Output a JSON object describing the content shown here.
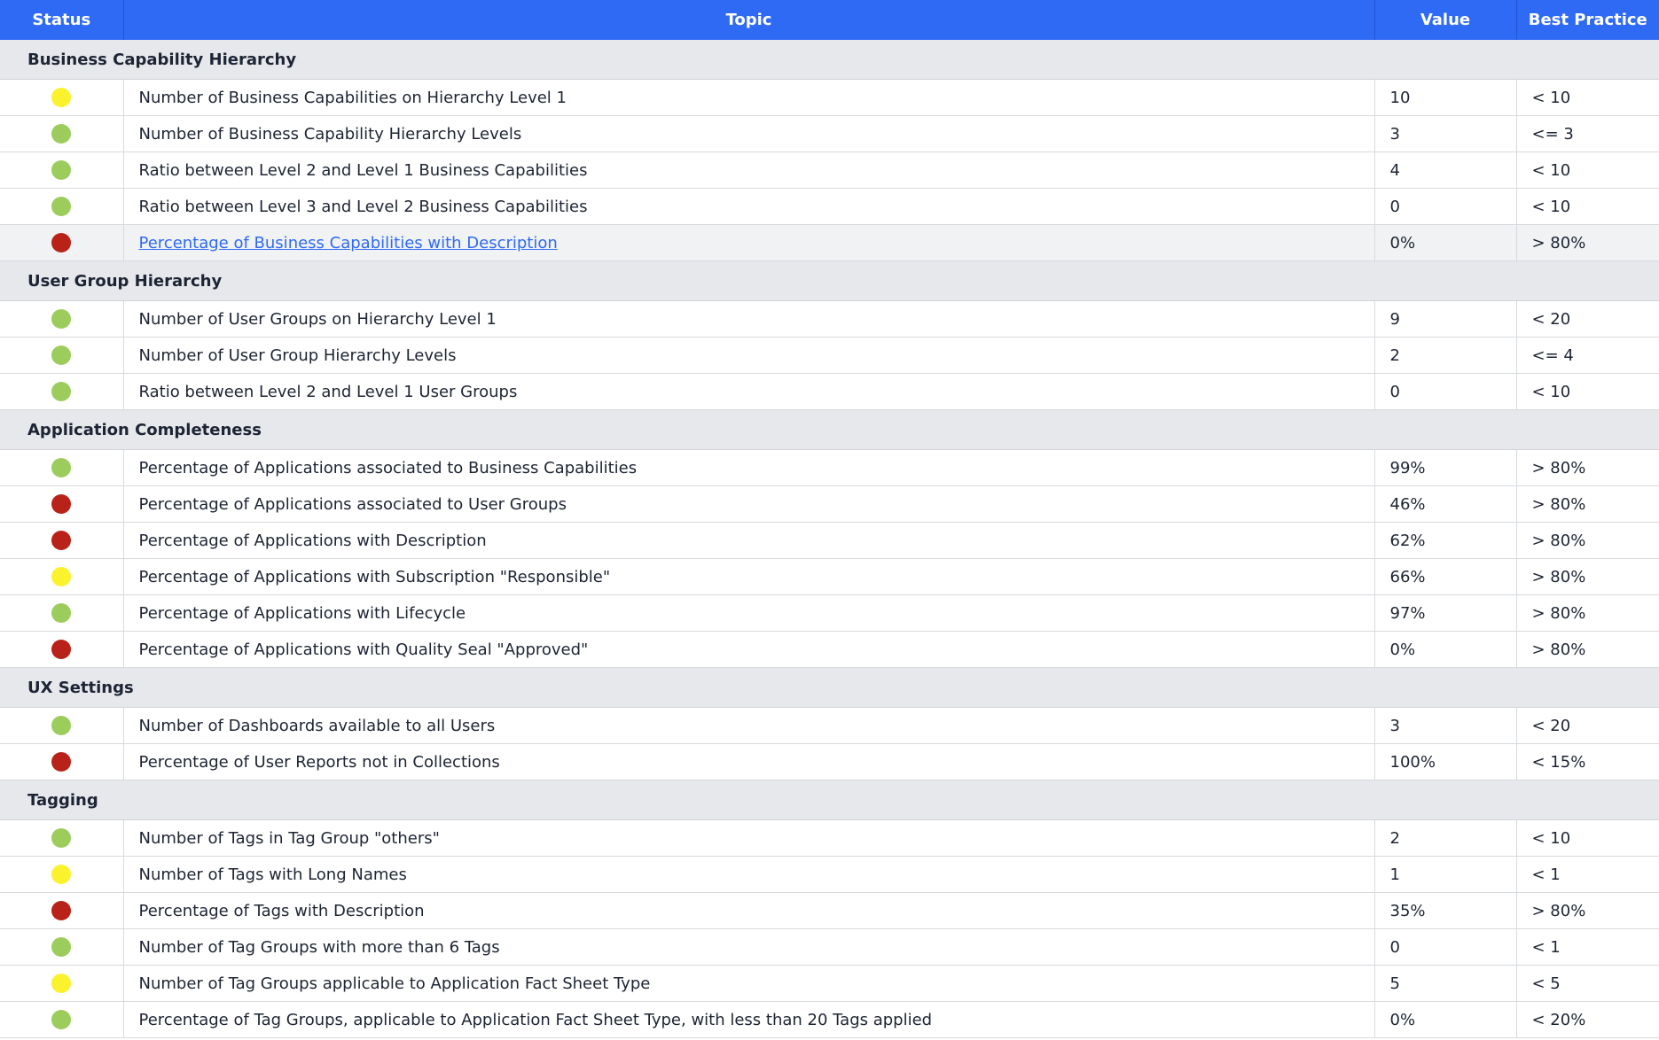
{
  "colors": {
    "header_bg": "#2f6af5",
    "group_bg": "#e6e8ec",
    "status_green": "#9ccd5c",
    "status_yellow": "#fbf22e",
    "status_red": "#b92219",
    "link": "#2f6af5"
  },
  "header": {
    "status": "Status",
    "topic": "Topic",
    "value": "Value",
    "best_practice": "Best Practice"
  },
  "groups": [
    {
      "title": "Business Capability Hierarchy",
      "rows": [
        {
          "status": "yellow",
          "topic": "Number of Business Capabilities on Hierarchy Level 1",
          "value": "10",
          "best_practice": "< 10"
        },
        {
          "status": "green",
          "topic": "Number of Business Capability Hierarchy Levels",
          "value": "3",
          "best_practice": "<= 3"
        },
        {
          "status": "green",
          "topic": "Ratio between Level 2 and Level 1 Business Capabilities",
          "value": "4",
          "best_practice": "< 10"
        },
        {
          "status": "green",
          "topic": "Ratio between Level 3 and Level 2 Business Capabilities",
          "value": "0",
          "best_practice": "< 10"
        },
        {
          "status": "red",
          "topic": "Percentage of Business Capabilities with Description",
          "value": "0%",
          "best_practice": "> 80%",
          "link": true
        }
      ]
    },
    {
      "title": "User Group Hierarchy",
      "rows": [
        {
          "status": "green",
          "topic": "Number of User Groups on Hierarchy Level 1",
          "value": "9",
          "best_practice": "< 20"
        },
        {
          "status": "green",
          "topic": "Number of User Group Hierarchy Levels",
          "value": "2",
          "best_practice": "<= 4"
        },
        {
          "status": "green",
          "topic": "Ratio between Level 2 and Level 1 User Groups",
          "value": "0",
          "best_practice": "< 10"
        }
      ]
    },
    {
      "title": "Application Completeness",
      "rows": [
        {
          "status": "green",
          "topic": "Percentage of Applications associated to Business Capabilities",
          "value": "99%",
          "best_practice": "> 80%"
        },
        {
          "status": "red",
          "topic": "Percentage of Applications associated to User Groups",
          "value": "46%",
          "best_practice": "> 80%"
        },
        {
          "status": "red",
          "topic": "Percentage of Applications with Description",
          "value": "62%",
          "best_practice": "> 80%"
        },
        {
          "status": "yellow",
          "topic": "Percentage of Applications with Subscription \"Responsible\"",
          "value": "66%",
          "best_practice": "> 80%"
        },
        {
          "status": "green",
          "topic": "Percentage of Applications with Lifecycle",
          "value": "97%",
          "best_practice": "> 80%"
        },
        {
          "status": "red",
          "topic": "Percentage of Applications with Quality Seal \"Approved\"",
          "value": "0%",
          "best_practice": "> 80%"
        }
      ]
    },
    {
      "title": "UX Settings",
      "rows": [
        {
          "status": "green",
          "topic": "Number of Dashboards available to all Users",
          "value": "3",
          "best_practice": "< 20"
        },
        {
          "status": "red",
          "topic": "Percentage of User Reports not in Collections",
          "value": "100%",
          "best_practice": "< 15%"
        }
      ]
    },
    {
      "title": "Tagging",
      "rows": [
        {
          "status": "green",
          "topic": "Number of Tags in Tag Group \"others\"",
          "value": "2",
          "best_practice": "< 10"
        },
        {
          "status": "yellow",
          "topic": "Number of Tags with Long Names",
          "value": "1",
          "best_practice": "< 1"
        },
        {
          "status": "red",
          "topic": "Percentage of Tags with Description",
          "value": "35%",
          "best_practice": "> 80%"
        },
        {
          "status": "green",
          "topic": "Number of Tag Groups with more than 6 Tags",
          "value": "0",
          "best_practice": "< 1"
        },
        {
          "status": "yellow",
          "topic": "Number of Tag Groups applicable to Application Fact Sheet Type",
          "value": "5",
          "best_practice": "< 5"
        },
        {
          "status": "green",
          "topic": "Percentage of Tag Groups, applicable to Application Fact Sheet Type, with less than 20 Tags applied",
          "value": "0%",
          "best_practice": "< 20%"
        }
      ]
    }
  ]
}
